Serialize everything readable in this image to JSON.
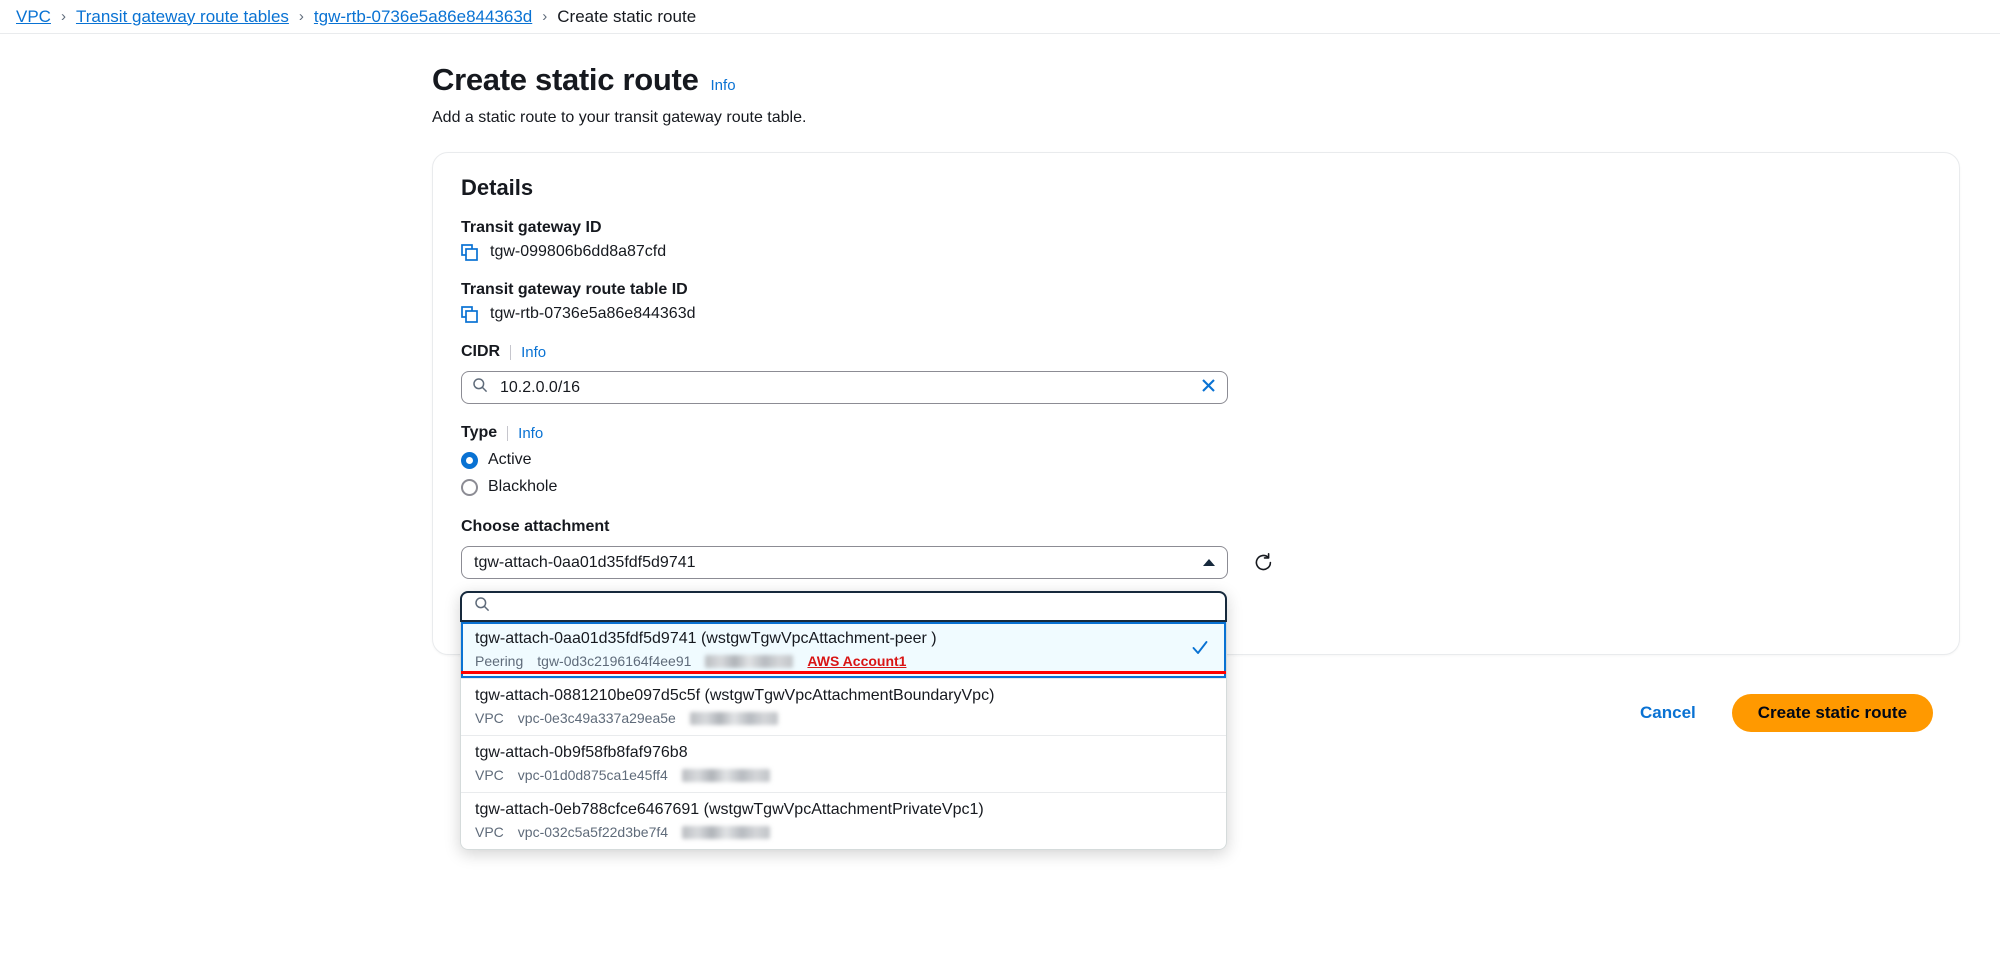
{
  "breadcrumb": {
    "items": [
      {
        "label": "VPC",
        "type": "link"
      },
      {
        "label": "Transit gateway route tables",
        "type": "link"
      },
      {
        "label": "tgw-rtb-0736e5a86e844363d",
        "type": "link"
      },
      {
        "label": "Create static route",
        "type": "current"
      }
    ],
    "separator": "›"
  },
  "header": {
    "title": "Create static route",
    "info_label": "Info",
    "description": "Add a static route to your transit gateway route table."
  },
  "details": {
    "section_title": "Details",
    "transit_gateway_id_label": "Transit gateway ID",
    "transit_gateway_id_value": "tgw-099806b6dd8a87cfd",
    "transit_gateway_route_table_id_label": "Transit gateway route table ID",
    "transit_gateway_route_table_id_value": "tgw-rtb-0736e5a86e844363d",
    "copy_icon": "copy-icon"
  },
  "cidr": {
    "label": "CIDR",
    "info_label": "Info",
    "value": "10.2.0.0/16",
    "placeholder": "",
    "search_icon": "search-icon",
    "clear_icon": "close-icon"
  },
  "type": {
    "label": "Type",
    "info_label": "Info",
    "options": [
      {
        "label": "Active",
        "selected": true
      },
      {
        "label": "Blackhole",
        "selected": false
      }
    ]
  },
  "attachment": {
    "label": "Choose attachment",
    "selected_value": "tgw-attach-0aa01d35fdf5d9741",
    "expanded": true,
    "caret_icon": "chevron-up-icon",
    "refresh_icon": "refresh-icon",
    "search_placeholder": "",
    "search_value": "",
    "search_icon": "search-icon",
    "options": [
      {
        "title": "tgw-attach-0aa01d35fdf5d9741 (wstgwTgwVpcAttachment-peer )",
        "resource_type": "Peering",
        "resource_id": "tgw-0d3c2196164f4ee91",
        "redacted": true,
        "account_label": "AWS Account1",
        "selected": true
      },
      {
        "title": "tgw-attach-0881210be097d5c5f (wstgwTgwVpcAttachmentBoundaryVpc)",
        "resource_type": "VPC",
        "resource_id": "vpc-0e3c49a337a29ea5e",
        "redacted": true,
        "account_label": "",
        "selected": false
      },
      {
        "title": "tgw-attach-0b9f58fb8faf976b8",
        "resource_type": "VPC",
        "resource_id": "vpc-01d0d875ca1e45ff4",
        "redacted": true,
        "account_label": "",
        "selected": false
      },
      {
        "title": "tgw-attach-0eb788cfce6467691 (wstgwTgwVpcAttachmentPrivateVpc1)",
        "resource_type": "VPC",
        "resource_id": "vpc-032c5a5f22d3be7f4",
        "redacted": true,
        "account_label": "",
        "selected": false
      }
    ]
  },
  "actions": {
    "cancel_label": "Cancel",
    "submit_label": "Create static route"
  },
  "colors": {
    "link_blue": "#0972d3",
    "primary_orange": "#ff9900",
    "highlight_red": "#ff0000",
    "account_red": "#d91515",
    "selected_bg": "#f0fbff"
  }
}
